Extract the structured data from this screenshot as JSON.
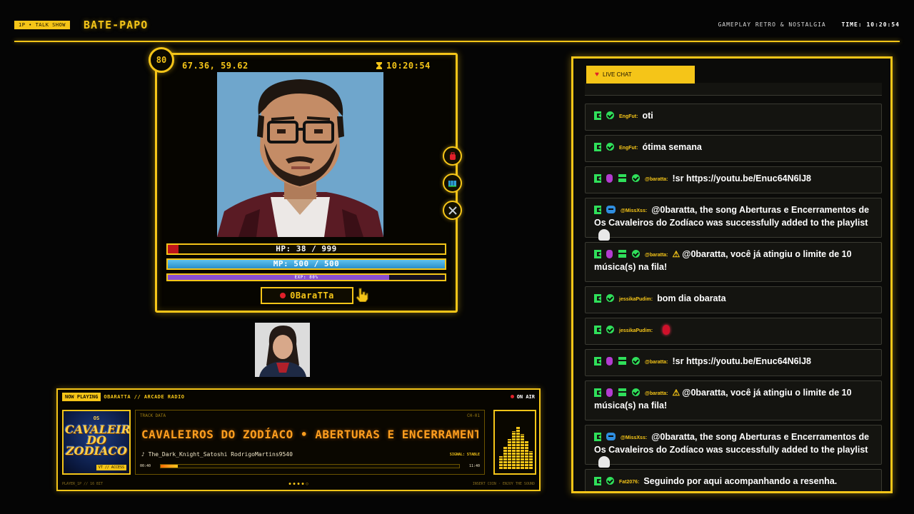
{
  "topbar": {
    "tag": "1P • TALK SHOW",
    "brand": "BATE-PAPO",
    "subtitle": "GAMEPLAY RETRO & NOSTALGIA",
    "time_label": "TIME:",
    "time": "10:20:54"
  },
  "player": {
    "level": "80",
    "coords": "67.36, 59.62",
    "time": "10:20:54",
    "hp": {
      "label": "HP: 38 / 999",
      "fraction": 0.038
    },
    "mp": {
      "label": "MP: 500 / 500",
      "fraction": 1.0
    },
    "exp": {
      "label": "EXP: 80%",
      "fraction": 0.8
    },
    "name": "0BaraTTa",
    "side_buttons": [
      "backpack-icon",
      "map-icon",
      "swords-icon"
    ]
  },
  "radio": {
    "now_playing": "NOW PLAYING",
    "station": "OBARATTA // ARCADE RADIO",
    "on_air": "ON AIR",
    "album_small": "OS",
    "album_title": "CAVALEIROS DO ZODIACO",
    "album_badge": "VT // ACCESS",
    "track_data_label": "TRACK DATA",
    "track_code": "CH-01",
    "track_title": "CAVALEIROS DO ZODÍACO • ABERTURAS E ENCERRAMENTOS",
    "artist": "The_Dark_Knight_Satoshi RodrigoMartins9540",
    "signal": "SIGNAL: STABLE",
    "elapsed": "00:40",
    "duration": "11:40",
    "progress": 0.057,
    "footer_left": "PLAYER_1P // 16 BIT",
    "footer_right": "INSERT COIN · ENJOY THE SOUND",
    "viz_levels": [
      0.25,
      0.45,
      0.6,
      0.75,
      0.85,
      0.7,
      0.55,
      0.35
    ]
  },
  "chat": {
    "header": "LIVE CHAT",
    "messages": [
      {
        "icons": [
          "k",
          "check"
        ],
        "user": "EngFut:",
        "text": "oti"
      },
      {
        "icons": [
          "k",
          "check"
        ],
        "user": "EngFut:",
        "text": "ótima semana"
      },
      {
        "icons": [
          "k",
          "mic",
          "gift",
          "check"
        ],
        "user": "@baratta:",
        "text": "!sr https://youtu.be/Enuc64N6lJ8"
      },
      {
        "icons": [
          "k",
          "bot"
        ],
        "user": "@MissXss:",
        "text": "@0baratta, the song Aberturas e Encerramentos de Os Cavaleiros do Zodíaco was successfully added to the playlist",
        "emote": "ghost"
      },
      {
        "icons": [
          "k",
          "mic",
          "gift",
          "check"
        ],
        "user": "@baratta:",
        "warn": "⚠",
        "text": "@0baratta, você já atingiu o limite de 10 música(s) na fila!"
      },
      {
        "icons": [
          "k",
          "check"
        ],
        "user": "jessikaPudim:",
        "text": "bom dia obarata"
      },
      {
        "icons": [
          "k",
          "check"
        ],
        "user": "jessikaPudim:",
        "text": "",
        "emote": "red"
      },
      {
        "icons": [
          "k",
          "mic",
          "gift",
          "check"
        ],
        "user": "@baratta:",
        "text": "!sr https://youtu.be/Enuc64N6lJ8"
      },
      {
        "icons": [
          "k",
          "mic",
          "gift",
          "check"
        ],
        "user": "@baratta:",
        "warn": "⚠",
        "text": "@0baratta, você já atingiu o limite de 10 música(s) na fila!"
      },
      {
        "icons": [
          "k",
          "bot"
        ],
        "user": "@MissXss:",
        "text": "@0baratta, the song Aberturas e Encerramentos de Os Cavaleiros do Zodíaco was successfully added to the playlist",
        "emote": "ghost"
      },
      {
        "icons": [
          "k",
          "check"
        ],
        "user": "Fat2076:",
        "text": "Seguindo por aqui acompanhando a resenha."
      }
    ]
  }
}
